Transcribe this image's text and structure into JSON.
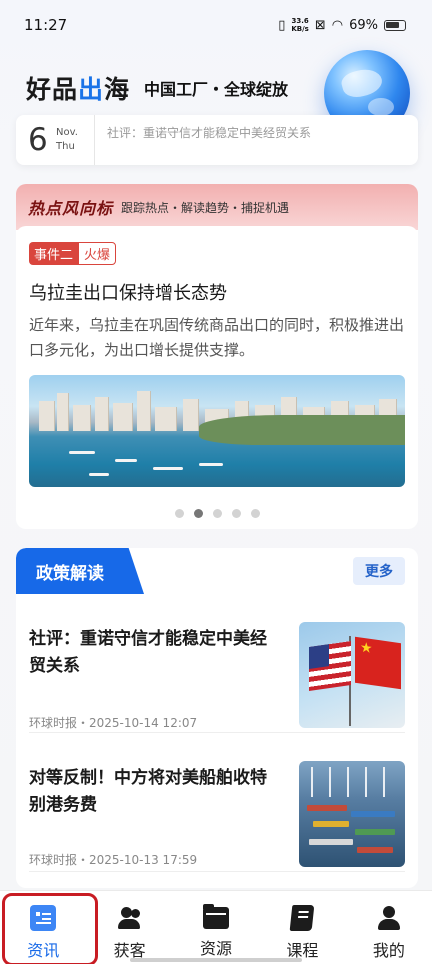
{
  "status_bar": {
    "time": "11:27",
    "net_speed_value": "33.6",
    "net_speed_unit": "KB/s",
    "battery": "69%"
  },
  "brand": {
    "logo_part1": "好品",
    "logo_accent": "出",
    "logo_part2": "海",
    "slogan": "中国工厂・全球绽放"
  },
  "date_card": {
    "day": "6",
    "month": "Nov.",
    "weekday": "Thu",
    "headline": "社评：重诺守信才能稳定中美经贸关系"
  },
  "hot_topics": {
    "title": "热点风向标",
    "subtitle": "跟踪热点・解读趋势・捕捉机遇",
    "tag_event": "事件二",
    "tag_hot": "火爆",
    "item_title": "乌拉圭出口保持增长态势",
    "item_desc": "近年来，乌拉圭在巩固传统商品出口的同时，积极推进出口多元化，为出口增长提供支撑。",
    "carousel_total": 5,
    "carousel_active": 2
  },
  "policy": {
    "tab_label": "政策解读",
    "more_label": "更多",
    "items": [
      {
        "title": "社评：重诺守信才能稳定中美经贸关系",
        "meta": "环球时报・2025-10-14 12:07"
      },
      {
        "title": "对等反制！中方将对美船舶收特别港务费",
        "meta": "环球时报・2025-10-13 17:59"
      }
    ]
  },
  "bottom_nav": {
    "items": [
      {
        "label": "资讯",
        "icon": "news-icon",
        "active": true
      },
      {
        "label": "获客",
        "icon": "users-icon",
        "active": false
      },
      {
        "label": "资源",
        "icon": "folder-icon",
        "active": false
      },
      {
        "label": "课程",
        "icon": "book-icon",
        "active": false
      },
      {
        "label": "我的",
        "icon": "person-icon",
        "active": false
      }
    ]
  },
  "colors": {
    "accent": "#1769e8",
    "hot_tag": "#d9453d",
    "highlight_box": "#c81c23"
  }
}
